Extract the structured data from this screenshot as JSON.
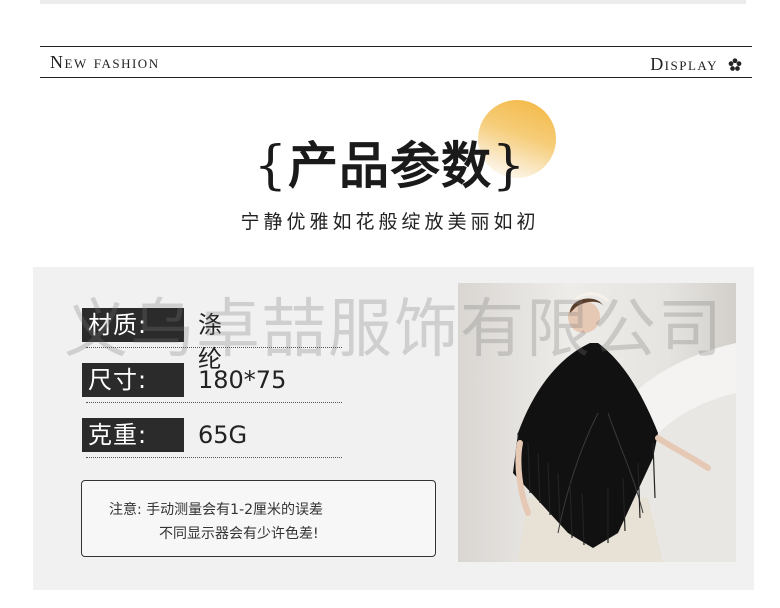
{
  "header": {
    "left_text": "New fashion",
    "right_text": "Display"
  },
  "title": {
    "open_brace": "{",
    "text": "产品参数",
    "close_brace": "}"
  },
  "subtitle": "宁静优雅如花般绽放美丽如初",
  "specs": [
    {
      "label": "材质:",
      "value": "涤纶"
    },
    {
      "label": "尺寸:",
      "value": "180*75"
    },
    {
      "label": "克重:",
      "value": "65G"
    }
  ],
  "note": {
    "line1": "注意:   手动测量会有1-2厘米的误差",
    "line2": "不同显示器会有少许色差!"
  },
  "watermark": "义乌卓喆服饰有限公司",
  "colors": {
    "accent": "#f3b640",
    "label_bg": "#2b2b2b",
    "panel_bg": "#f1f1f1"
  },
  "icons": {
    "header_ornament": "flower-icon"
  },
  "photo": {
    "subject": "woman-in-black-lace-fringed-shawl"
  }
}
